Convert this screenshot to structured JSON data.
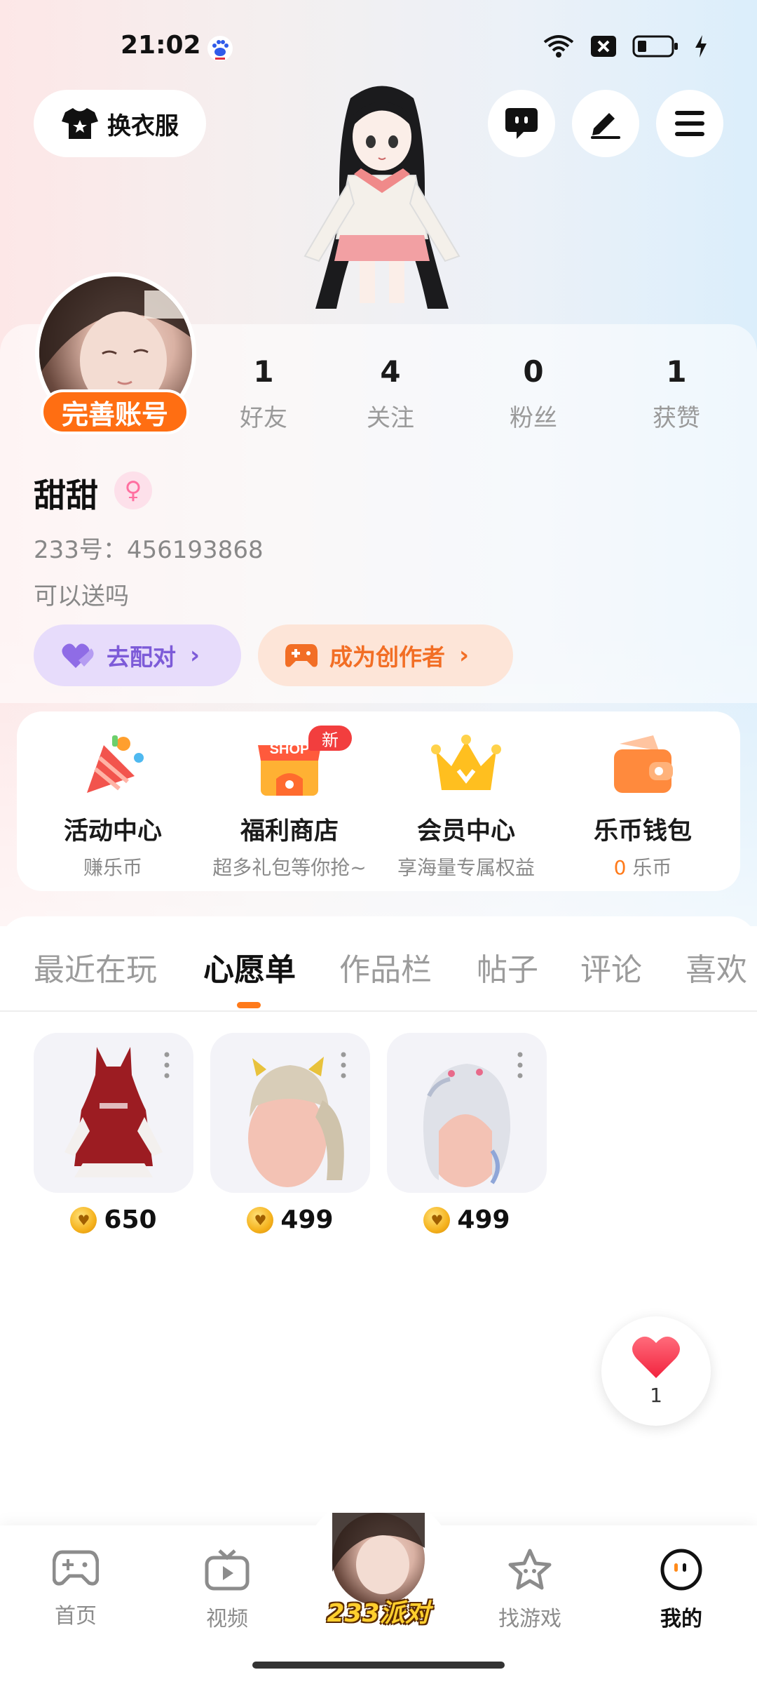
{
  "status_bar": {
    "time": "21:02",
    "icons": [
      "baidu-icon",
      "wifi-icon",
      "no-sim-icon",
      "battery-icon",
      "charging-icon"
    ]
  },
  "header": {
    "dressup_label": "换衣服",
    "icons": [
      "tshirt-icon",
      "message-icon",
      "edit-icon",
      "menu-icon"
    ]
  },
  "profile": {
    "complete_badge": "完善账号",
    "stats": [
      {
        "value": "1",
        "label": "好友"
      },
      {
        "value": "4",
        "label": "关注"
      },
      {
        "value": "0",
        "label": "粉丝"
      },
      {
        "value": "1",
        "label": "获赞"
      }
    ],
    "username": "甜甜",
    "gender_symbol": "♀",
    "uid": "233号：456193868",
    "bio": "可以送吗",
    "match_label": "去配对",
    "creator_label": "成为创作者",
    "chevron": "›"
  },
  "features": [
    {
      "title": "活动中心",
      "subtitle": "赚乐币",
      "icon": "party-popper-icon"
    },
    {
      "title": "福利商店",
      "subtitle": "超多礼包等你抢~",
      "icon": "shop-icon",
      "badge": "新",
      "icon_text": "SHOP"
    },
    {
      "title": "会员中心",
      "subtitle": "享海量专属权益",
      "icon": "crown-icon"
    },
    {
      "title": "乐币钱包",
      "subtitle_num": "0",
      "subtitle_unit": " 乐币",
      "icon": "wallet-icon"
    }
  ],
  "tabs": [
    "最近在玩",
    "心愿单",
    "作品栏",
    "帖子",
    "评论",
    "喜欢"
  ],
  "active_tab": "心愿单",
  "wishlist": [
    {
      "price": "650",
      "name_icon": "red-hood-outfit"
    },
    {
      "price": "499",
      "name_icon": "blonde-twintail-hair"
    },
    {
      "price": "499",
      "name_icon": "silver-hair"
    }
  ],
  "like_bubble": {
    "count": "1"
  },
  "bottom_nav": {
    "items": [
      {
        "label": "首页",
        "icon": "gamepad-icon"
      },
      {
        "label": "视频",
        "icon": "tv-icon"
      },
      {
        "label": "233派对",
        "icon": "party-avatar"
      },
      {
        "label": "找游戏",
        "icon": "star-icon"
      },
      {
        "label": "我的",
        "icon": "profile-face-icon"
      }
    ]
  },
  "colors": {
    "accent": "#ff7a1a",
    "badge_orange": "#ff6e12",
    "match_purple": "#7d5bd8",
    "new_red": "#f23e3e"
  }
}
